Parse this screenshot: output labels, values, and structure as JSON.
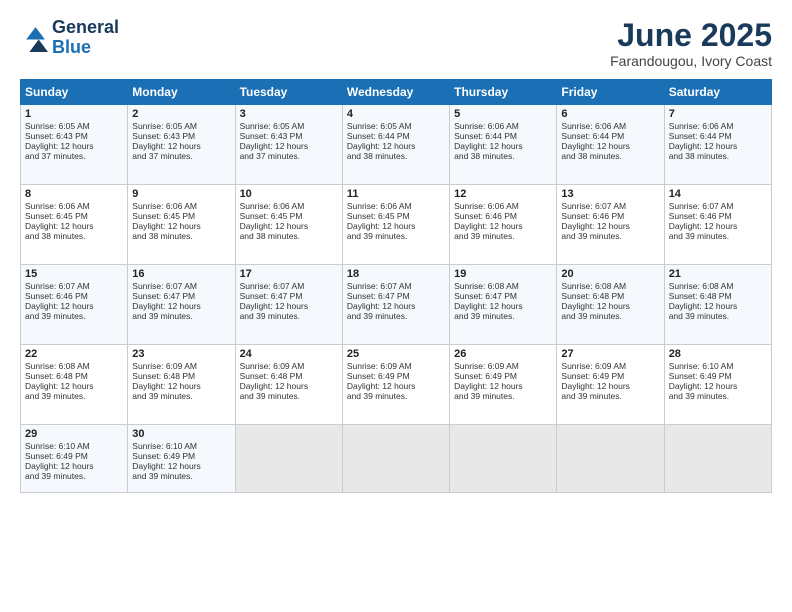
{
  "header": {
    "logo_line1": "General",
    "logo_line2": "Blue",
    "month_title": "June 2025",
    "location": "Farandougou, Ivory Coast"
  },
  "days_of_week": [
    "Sunday",
    "Monday",
    "Tuesday",
    "Wednesday",
    "Thursday",
    "Friday",
    "Saturday"
  ],
  "weeks": [
    [
      {
        "day": "1",
        "lines": [
          "Sunrise: 6:05 AM",
          "Sunset: 6:43 PM",
          "Daylight: 12 hours",
          "and 37 minutes."
        ]
      },
      {
        "day": "2",
        "lines": [
          "Sunrise: 6:05 AM",
          "Sunset: 6:43 PM",
          "Daylight: 12 hours",
          "and 37 minutes."
        ]
      },
      {
        "day": "3",
        "lines": [
          "Sunrise: 6:05 AM",
          "Sunset: 6:43 PM",
          "Daylight: 12 hours",
          "and 37 minutes."
        ]
      },
      {
        "day": "4",
        "lines": [
          "Sunrise: 6:05 AM",
          "Sunset: 6:44 PM",
          "Daylight: 12 hours",
          "and 38 minutes."
        ]
      },
      {
        "day": "5",
        "lines": [
          "Sunrise: 6:06 AM",
          "Sunset: 6:44 PM",
          "Daylight: 12 hours",
          "and 38 minutes."
        ]
      },
      {
        "day": "6",
        "lines": [
          "Sunrise: 6:06 AM",
          "Sunset: 6:44 PM",
          "Daylight: 12 hours",
          "and 38 minutes."
        ]
      },
      {
        "day": "7",
        "lines": [
          "Sunrise: 6:06 AM",
          "Sunset: 6:44 PM",
          "Daylight: 12 hours",
          "and 38 minutes."
        ]
      }
    ],
    [
      {
        "day": "8",
        "lines": [
          "Sunrise: 6:06 AM",
          "Sunset: 6:45 PM",
          "Daylight: 12 hours",
          "and 38 minutes."
        ]
      },
      {
        "day": "9",
        "lines": [
          "Sunrise: 6:06 AM",
          "Sunset: 6:45 PM",
          "Daylight: 12 hours",
          "and 38 minutes."
        ]
      },
      {
        "day": "10",
        "lines": [
          "Sunrise: 6:06 AM",
          "Sunset: 6:45 PM",
          "Daylight: 12 hours",
          "and 38 minutes."
        ]
      },
      {
        "day": "11",
        "lines": [
          "Sunrise: 6:06 AM",
          "Sunset: 6:45 PM",
          "Daylight: 12 hours",
          "and 39 minutes."
        ]
      },
      {
        "day": "12",
        "lines": [
          "Sunrise: 6:06 AM",
          "Sunset: 6:46 PM",
          "Daylight: 12 hours",
          "and 39 minutes."
        ]
      },
      {
        "day": "13",
        "lines": [
          "Sunrise: 6:07 AM",
          "Sunset: 6:46 PM",
          "Daylight: 12 hours",
          "and 39 minutes."
        ]
      },
      {
        "day": "14",
        "lines": [
          "Sunrise: 6:07 AM",
          "Sunset: 6:46 PM",
          "Daylight: 12 hours",
          "and 39 minutes."
        ]
      }
    ],
    [
      {
        "day": "15",
        "lines": [
          "Sunrise: 6:07 AM",
          "Sunset: 6:46 PM",
          "Daylight: 12 hours",
          "and 39 minutes."
        ]
      },
      {
        "day": "16",
        "lines": [
          "Sunrise: 6:07 AM",
          "Sunset: 6:47 PM",
          "Daylight: 12 hours",
          "and 39 minutes."
        ]
      },
      {
        "day": "17",
        "lines": [
          "Sunrise: 6:07 AM",
          "Sunset: 6:47 PM",
          "Daylight: 12 hours",
          "and 39 minutes."
        ]
      },
      {
        "day": "18",
        "lines": [
          "Sunrise: 6:07 AM",
          "Sunset: 6:47 PM",
          "Daylight: 12 hours",
          "and 39 minutes."
        ]
      },
      {
        "day": "19",
        "lines": [
          "Sunrise: 6:08 AM",
          "Sunset: 6:47 PM",
          "Daylight: 12 hours",
          "and 39 minutes."
        ]
      },
      {
        "day": "20",
        "lines": [
          "Sunrise: 6:08 AM",
          "Sunset: 6:48 PM",
          "Daylight: 12 hours",
          "and 39 minutes."
        ]
      },
      {
        "day": "21",
        "lines": [
          "Sunrise: 6:08 AM",
          "Sunset: 6:48 PM",
          "Daylight: 12 hours",
          "and 39 minutes."
        ]
      }
    ],
    [
      {
        "day": "22",
        "lines": [
          "Sunrise: 6:08 AM",
          "Sunset: 6:48 PM",
          "Daylight: 12 hours",
          "and 39 minutes."
        ]
      },
      {
        "day": "23",
        "lines": [
          "Sunrise: 6:09 AM",
          "Sunset: 6:48 PM",
          "Daylight: 12 hours",
          "and 39 minutes."
        ]
      },
      {
        "day": "24",
        "lines": [
          "Sunrise: 6:09 AM",
          "Sunset: 6:48 PM",
          "Daylight: 12 hours",
          "and 39 minutes."
        ]
      },
      {
        "day": "25",
        "lines": [
          "Sunrise: 6:09 AM",
          "Sunset: 6:49 PM",
          "Daylight: 12 hours",
          "and 39 minutes."
        ]
      },
      {
        "day": "26",
        "lines": [
          "Sunrise: 6:09 AM",
          "Sunset: 6:49 PM",
          "Daylight: 12 hours",
          "and 39 minutes."
        ]
      },
      {
        "day": "27",
        "lines": [
          "Sunrise: 6:09 AM",
          "Sunset: 6:49 PM",
          "Daylight: 12 hours",
          "and 39 minutes."
        ]
      },
      {
        "day": "28",
        "lines": [
          "Sunrise: 6:10 AM",
          "Sunset: 6:49 PM",
          "Daylight: 12 hours",
          "and 39 minutes."
        ]
      }
    ],
    [
      {
        "day": "29",
        "lines": [
          "Sunrise: 6:10 AM",
          "Sunset: 6:49 PM",
          "Daylight: 12 hours",
          "and 39 minutes."
        ]
      },
      {
        "day": "30",
        "lines": [
          "Sunrise: 6:10 AM",
          "Sunset: 6:49 PM",
          "Daylight: 12 hours",
          "and 39 minutes."
        ]
      },
      {
        "day": "",
        "lines": []
      },
      {
        "day": "",
        "lines": []
      },
      {
        "day": "",
        "lines": []
      },
      {
        "day": "",
        "lines": []
      },
      {
        "day": "",
        "lines": []
      }
    ]
  ]
}
